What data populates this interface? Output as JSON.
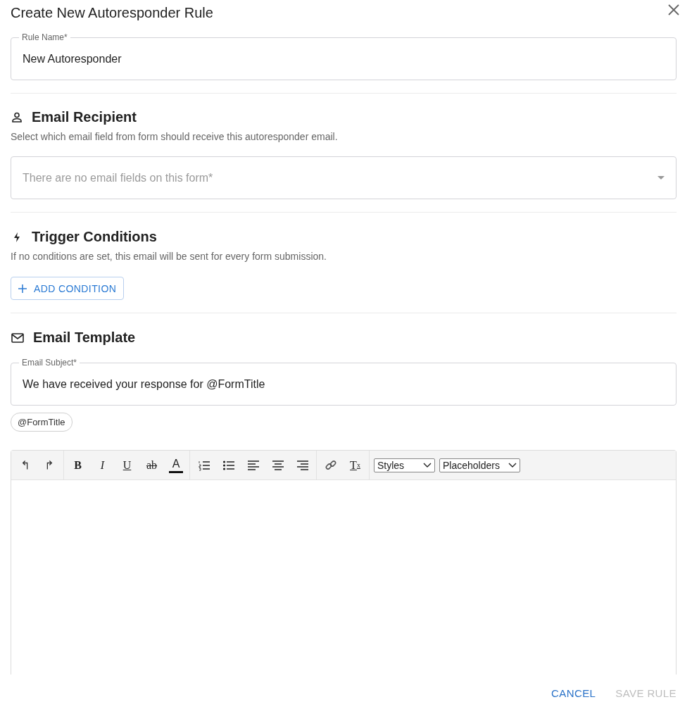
{
  "dialog": {
    "title": "Create New Autoresponder Rule"
  },
  "rule_name": {
    "label": "Rule Name*",
    "value": "New Autoresponder"
  },
  "sections": [
    {
      "kind": "recipient",
      "heading": "Email Recipient",
      "description": "Select which email field from form should receive this autoresponder email.",
      "select": {
        "placeholder": "There are no email fields on this form*"
      }
    },
    {
      "kind": "trigger",
      "heading": "Trigger Conditions",
      "description": "If no conditions are set, this email will be sent for every form submission.",
      "button": {
        "label": "ADD CONDITION"
      }
    },
    {
      "kind": "template",
      "heading": "Email Template",
      "subject": {
        "label": "Email Subject*",
        "value": "We have received your response for @FormTitle"
      },
      "chips": [
        "@FormTitle"
      ]
    }
  ],
  "editor": {
    "toolbar": [
      [
        {
          "kind": "undo"
        },
        {
          "kind": "redo"
        }
      ],
      [
        {
          "kind": "bold",
          "label": "B"
        },
        {
          "kind": "italic",
          "label": "I"
        },
        {
          "kind": "underline",
          "label": "U"
        },
        {
          "kind": "strike",
          "label": "ab"
        },
        {
          "kind": "color",
          "label": "A"
        }
      ],
      [
        {
          "kind": "ordered-list"
        },
        {
          "kind": "bullet-list"
        },
        {
          "kind": "align-left"
        },
        {
          "kind": "align-center"
        },
        {
          "kind": "align-right"
        }
      ],
      [
        {
          "kind": "link"
        },
        {
          "kind": "clear",
          "label": "T",
          "sub": "x"
        }
      ]
    ],
    "dropdowns": [
      "Styles",
      "Placeholders"
    ]
  },
  "footer": {
    "buttons": [
      {
        "label": "CANCEL",
        "disabled": false
      },
      {
        "label": "SAVE RULE",
        "disabled": true
      }
    ]
  }
}
